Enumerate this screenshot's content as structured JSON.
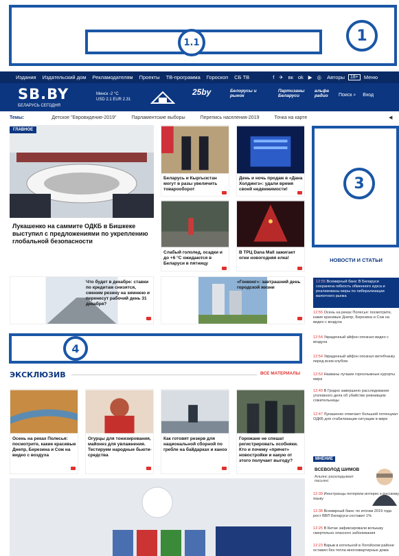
{
  "annotations": {
    "label_1": "1",
    "label_1_1": "1.1",
    "label_3": "3",
    "label_4": "4"
  },
  "topnav": {
    "items": [
      "Издания",
      "Издательский дом",
      "Рекламодателям",
      "Проекты",
      "ТВ-программа",
      "Гороскоп",
      "СБ ТВ"
    ],
    "social": [
      "f",
      "✈",
      "вк",
      "ok",
      "▶",
      "◎"
    ],
    "authors": "Авторы",
    "age": "18+",
    "menu": "Меню"
  },
  "header": {
    "logo": "SB.BY",
    "logo_sub": "БЕЛАРУСЬ СЕГОДНЯ",
    "weather": "Минск -2 °C",
    "rates": "USD 2.1    EUR 2.31",
    "partner1": "25by",
    "partner2": "Белорусы и рынок",
    "partner3": "Партизаны Беларуси",
    "partner4": "альфа радио",
    "search": "Поиск",
    "login": "Вход"
  },
  "themes": {
    "label": "Темы:",
    "items": [
      "Детское \"Евровидение-2019\"",
      "Парламентские выборы",
      "Перепись населения-2019",
      "Точка на карте"
    ]
  },
  "main": {
    "badge": "ГЛАВНОЕ",
    "headline": "Лукашенко на саммите ОДКБ в Бишкеке выступил с предложениями по укреплению глобальной безопасности",
    "tiles": [
      {
        "caption": "Беларусь и Кыргызстан могут в разы увеличить товарооборот"
      },
      {
        "caption": "День и ночь продаж в «Дана Холдингз»: удали время своей недвижимости!"
      },
      {
        "caption": "Слабый гололед, осадки и до +6 °С ожидаются в Беларуси в пятницу"
      },
      {
        "caption": "В ТРЦ Dana Mall зажигает огни новогодняя елка!"
      },
      {
        "caption": "Что будет в декабре: ставки по кредитам снизятся, сменим резину на зимнюю и перенесут рабочий день 31 декабря?"
      },
      {
        "caption": "«Гонконг»: завтрашний день городской жизни"
      }
    ]
  },
  "sidebar": {
    "title": "НОВОСТИ И СТАТЬИ",
    "news": [
      {
        "time": "12:55",
        "text": "Всемирный банк: В Беларуси сохранена гибкость обменного курса и реализованы меры по либерализации валютного рынка"
      },
      {
        "time": "12:55",
        "text": "Осень на реках Полесья: посмотрите, какие красивые Днепр, Березина и Сож на видео с воздуха"
      },
      {
        "time": "12:54",
        "text": "Украденный айфон опознал видео с воздуха"
      },
      {
        "time": "12:54",
        "text": "Украденный айфон опознал витебчанку перед всем клубом"
      },
      {
        "time": "12:53",
        "text": "Названы лучшие горнолыжные курорты мира"
      },
      {
        "time": "12:49",
        "text": "В Гродно завершено расследование уголовного дела об убийстве ревнивцем сожительницы"
      },
      {
        "time": "12:47",
        "text": "Лукашенко отмечает большой потенциал ОДКБ для стабилизации ситуации в мире"
      },
      {
        "time": "12:39",
        "text": "Иностранцы потеряли интерес к русскому языку"
      },
      {
        "time": "12:38",
        "text": "Всемирный банк: по итогам 2019 года рост ВВП Беларуси составит 1%"
      },
      {
        "time": "12:25",
        "text": "В Китае зафиксировали вспышку смертельно опасного заболевания"
      },
      {
        "time": "12:23",
        "text": "Взрыв в котельной в Логойском районе оставил без тепла многоквартирные дома"
      }
    ],
    "opinion_label": "МНЕНИЕ",
    "opinion_author": "ВСЕВОЛОД ШИМОВ",
    "opinion_text": "Альянс раскладывает пасьянс"
  },
  "exclusive": {
    "title": "ЭКСКЛЮЗИВ",
    "all": "ВСЕ МАТЕРИАЛЫ",
    "items": [
      {
        "caption": "Осень на реках Полесья: посмотрите, какие красивые Днепр, Березина и Сож на видео с воздуха"
      },
      {
        "caption": "Огурцы для тонизирования, майонез для увлажнения. Тестируем народные бьюти-средства"
      },
      {
        "caption": "Как готовят резерв для национальной сборной по гребле на байдарках и каноэ"
      },
      {
        "caption": "Горожане не спешат регистрировать особняки. Кто и почему «прячет» новостройки и какую от этого получает выгоду?"
      }
    ]
  }
}
